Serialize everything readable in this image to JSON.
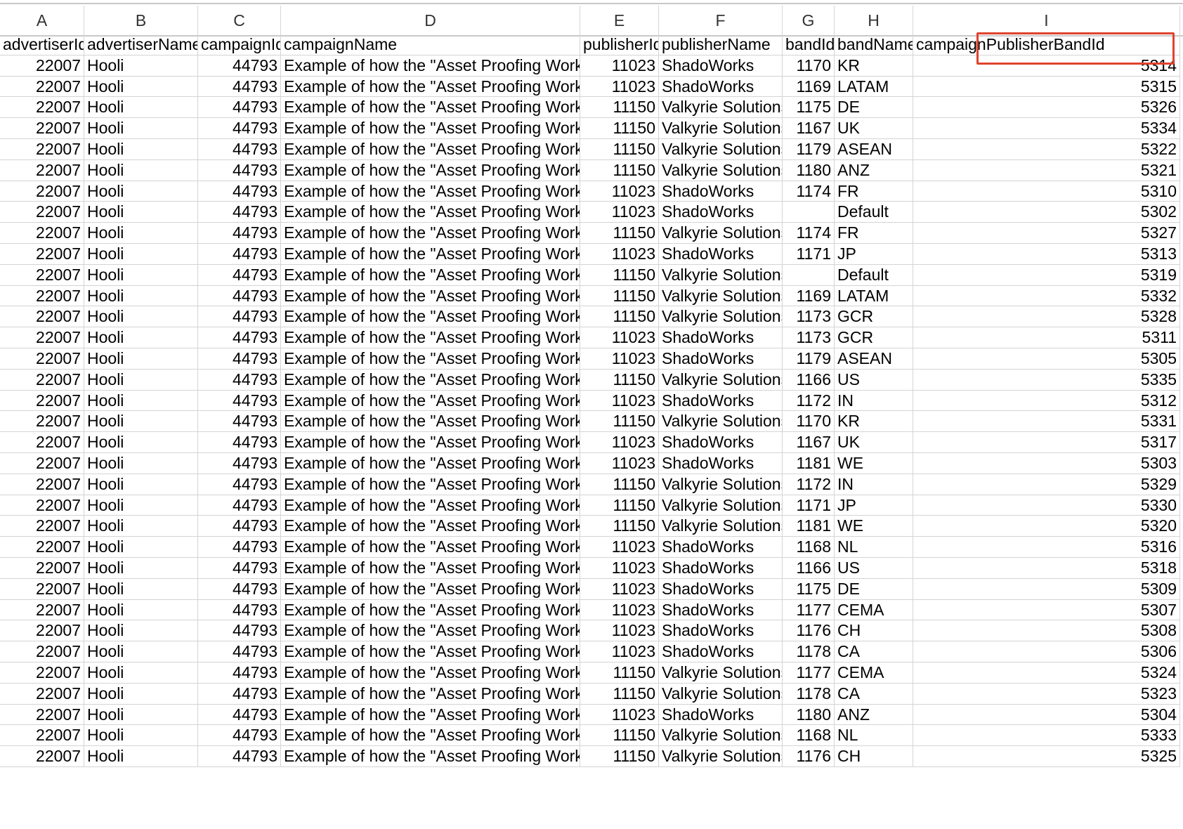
{
  "columns": [
    {
      "letter": "A",
      "header": "advertiserId",
      "key": "advertiserId",
      "align": "num"
    },
    {
      "letter": "B",
      "header": "advertiserName",
      "key": "advertiserName",
      "align": "txt"
    },
    {
      "letter": "C",
      "header": "campaignId",
      "key": "campaignId",
      "align": "num"
    },
    {
      "letter": "D",
      "header": "campaignName",
      "key": "campaignName",
      "align": "txt"
    },
    {
      "letter": "E",
      "header": "publisherId",
      "key": "publisherId",
      "align": "num"
    },
    {
      "letter": "F",
      "header": "publisherName",
      "key": "publisherName",
      "align": "txt"
    },
    {
      "letter": "G",
      "header": "bandId",
      "key": "bandId",
      "align": "num"
    },
    {
      "letter": "H",
      "header": "bandName",
      "key": "bandName",
      "align": "txt"
    },
    {
      "letter": "I",
      "header": "campaignPublisherBandId",
      "key": "campaignPublisherBandId",
      "align": "num"
    }
  ],
  "highlight_color": "#e0422e",
  "rows": [
    {
      "advertiserId": "22007",
      "advertiserName": "Hooli",
      "campaignId": "44793",
      "campaignName": "Example of how the \"Asset Proofing Works\"",
      "publisherId": "11023",
      "publisherName": "ShadoWorks",
      "bandId": "1170",
      "bandName": "KR",
      "campaignPublisherBandId": "5314"
    },
    {
      "advertiserId": "22007",
      "advertiserName": "Hooli",
      "campaignId": "44793",
      "campaignName": "Example of how the \"Asset Proofing Works\"",
      "publisherId": "11023",
      "publisherName": "ShadoWorks",
      "bandId": "1169",
      "bandName": "LATAM",
      "campaignPublisherBandId": "5315"
    },
    {
      "advertiserId": "22007",
      "advertiserName": "Hooli",
      "campaignId": "44793",
      "campaignName": "Example of how the \"Asset Proofing Works\"",
      "publisherId": "11150",
      "publisherName": "Valkyrie Solutions",
      "bandId": "1175",
      "bandName": "DE",
      "campaignPublisherBandId": "5326"
    },
    {
      "advertiserId": "22007",
      "advertiserName": "Hooli",
      "campaignId": "44793",
      "campaignName": "Example of how the \"Asset Proofing Works\"",
      "publisherId": "11150",
      "publisherName": "Valkyrie Solutions",
      "bandId": "1167",
      "bandName": "UK",
      "campaignPublisherBandId": "5334"
    },
    {
      "advertiserId": "22007",
      "advertiserName": "Hooli",
      "campaignId": "44793",
      "campaignName": "Example of how the \"Asset Proofing Works\"",
      "publisherId": "11150",
      "publisherName": "Valkyrie Solutions",
      "bandId": "1179",
      "bandName": "ASEAN",
      "campaignPublisherBandId": "5322"
    },
    {
      "advertiserId": "22007",
      "advertiserName": "Hooli",
      "campaignId": "44793",
      "campaignName": "Example of how the \"Asset Proofing Works\"",
      "publisherId": "11150",
      "publisherName": "Valkyrie Solutions",
      "bandId": "1180",
      "bandName": "ANZ",
      "campaignPublisherBandId": "5321"
    },
    {
      "advertiserId": "22007",
      "advertiserName": "Hooli",
      "campaignId": "44793",
      "campaignName": "Example of how the \"Asset Proofing Works\"",
      "publisherId": "11023",
      "publisherName": "ShadoWorks",
      "bandId": "1174",
      "bandName": "FR",
      "campaignPublisherBandId": "5310"
    },
    {
      "advertiserId": "22007",
      "advertiserName": "Hooli",
      "campaignId": "44793",
      "campaignName": "Example of how the \"Asset Proofing Works\"",
      "publisherId": "11023",
      "publisherName": "ShadoWorks",
      "bandId": "",
      "bandName": "Default",
      "campaignPublisherBandId": "5302"
    },
    {
      "advertiserId": "22007",
      "advertiserName": "Hooli",
      "campaignId": "44793",
      "campaignName": "Example of how the \"Asset Proofing Works\"",
      "publisherId": "11150",
      "publisherName": "Valkyrie Solutions",
      "bandId": "1174",
      "bandName": "FR",
      "campaignPublisherBandId": "5327"
    },
    {
      "advertiserId": "22007",
      "advertiserName": "Hooli",
      "campaignId": "44793",
      "campaignName": "Example of how the \"Asset Proofing Works\"",
      "publisherId": "11023",
      "publisherName": "ShadoWorks",
      "bandId": "1171",
      "bandName": "JP",
      "campaignPublisherBandId": "5313"
    },
    {
      "advertiserId": "22007",
      "advertiserName": "Hooli",
      "campaignId": "44793",
      "campaignName": "Example of how the \"Asset Proofing Works\"",
      "publisherId": "11150",
      "publisherName": "Valkyrie Solutions",
      "bandId": "",
      "bandName": "Default",
      "campaignPublisherBandId": "5319"
    },
    {
      "advertiserId": "22007",
      "advertiserName": "Hooli",
      "campaignId": "44793",
      "campaignName": "Example of how the \"Asset Proofing Works\"",
      "publisherId": "11150",
      "publisherName": "Valkyrie Solutions",
      "bandId": "1169",
      "bandName": "LATAM",
      "campaignPublisherBandId": "5332"
    },
    {
      "advertiserId": "22007",
      "advertiserName": "Hooli",
      "campaignId": "44793",
      "campaignName": "Example of how the \"Asset Proofing Works\"",
      "publisherId": "11150",
      "publisherName": "Valkyrie Solutions",
      "bandId": "1173",
      "bandName": "GCR",
      "campaignPublisherBandId": "5328"
    },
    {
      "advertiserId": "22007",
      "advertiserName": "Hooli",
      "campaignId": "44793",
      "campaignName": "Example of how the \"Asset Proofing Works\"",
      "publisherId": "11023",
      "publisherName": "ShadoWorks",
      "bandId": "1173",
      "bandName": "GCR",
      "campaignPublisherBandId": "5311"
    },
    {
      "advertiserId": "22007",
      "advertiserName": "Hooli",
      "campaignId": "44793",
      "campaignName": "Example of how the \"Asset Proofing Works\"",
      "publisherId": "11023",
      "publisherName": "ShadoWorks",
      "bandId": "1179",
      "bandName": "ASEAN",
      "campaignPublisherBandId": "5305"
    },
    {
      "advertiserId": "22007",
      "advertiserName": "Hooli",
      "campaignId": "44793",
      "campaignName": "Example of how the \"Asset Proofing Works\"",
      "publisherId": "11150",
      "publisherName": "Valkyrie Solutions",
      "bandId": "1166",
      "bandName": "US",
      "campaignPublisherBandId": "5335"
    },
    {
      "advertiserId": "22007",
      "advertiserName": "Hooli",
      "campaignId": "44793",
      "campaignName": "Example of how the \"Asset Proofing Works\"",
      "publisherId": "11023",
      "publisherName": "ShadoWorks",
      "bandId": "1172",
      "bandName": "IN",
      "campaignPublisherBandId": "5312"
    },
    {
      "advertiserId": "22007",
      "advertiserName": "Hooli",
      "campaignId": "44793",
      "campaignName": "Example of how the \"Asset Proofing Works\"",
      "publisherId": "11150",
      "publisherName": "Valkyrie Solutions",
      "bandId": "1170",
      "bandName": "KR",
      "campaignPublisherBandId": "5331"
    },
    {
      "advertiserId": "22007",
      "advertiserName": "Hooli",
      "campaignId": "44793",
      "campaignName": "Example of how the \"Asset Proofing Works\"",
      "publisherId": "11023",
      "publisherName": "ShadoWorks",
      "bandId": "1167",
      "bandName": "UK",
      "campaignPublisherBandId": "5317"
    },
    {
      "advertiserId": "22007",
      "advertiserName": "Hooli",
      "campaignId": "44793",
      "campaignName": "Example of how the \"Asset Proofing Works\"",
      "publisherId": "11023",
      "publisherName": "ShadoWorks",
      "bandId": "1181",
      "bandName": "WE",
      "campaignPublisherBandId": "5303"
    },
    {
      "advertiserId": "22007",
      "advertiserName": "Hooli",
      "campaignId": "44793",
      "campaignName": "Example of how the \"Asset Proofing Works\"",
      "publisherId": "11150",
      "publisherName": "Valkyrie Solutions",
      "bandId": "1172",
      "bandName": "IN",
      "campaignPublisherBandId": "5329"
    },
    {
      "advertiserId": "22007",
      "advertiserName": "Hooli",
      "campaignId": "44793",
      "campaignName": "Example of how the \"Asset Proofing Works\"",
      "publisherId": "11150",
      "publisherName": "Valkyrie Solutions",
      "bandId": "1171",
      "bandName": "JP",
      "campaignPublisherBandId": "5330"
    },
    {
      "advertiserId": "22007",
      "advertiserName": "Hooli",
      "campaignId": "44793",
      "campaignName": "Example of how the \"Asset Proofing Works\"",
      "publisherId": "11150",
      "publisherName": "Valkyrie Solutions",
      "bandId": "1181",
      "bandName": "WE",
      "campaignPublisherBandId": "5320"
    },
    {
      "advertiserId": "22007",
      "advertiserName": "Hooli",
      "campaignId": "44793",
      "campaignName": "Example of how the \"Asset Proofing Works\"",
      "publisherId": "11023",
      "publisherName": "ShadoWorks",
      "bandId": "1168",
      "bandName": "NL",
      "campaignPublisherBandId": "5316"
    },
    {
      "advertiserId": "22007",
      "advertiserName": "Hooli",
      "campaignId": "44793",
      "campaignName": "Example of how the \"Asset Proofing Works\"",
      "publisherId": "11023",
      "publisherName": "ShadoWorks",
      "bandId": "1166",
      "bandName": "US",
      "campaignPublisherBandId": "5318"
    },
    {
      "advertiserId": "22007",
      "advertiserName": "Hooli",
      "campaignId": "44793",
      "campaignName": "Example of how the \"Asset Proofing Works\"",
      "publisherId": "11023",
      "publisherName": "ShadoWorks",
      "bandId": "1175",
      "bandName": "DE",
      "campaignPublisherBandId": "5309"
    },
    {
      "advertiserId": "22007",
      "advertiserName": "Hooli",
      "campaignId": "44793",
      "campaignName": "Example of how the \"Asset Proofing Works\"",
      "publisherId": "11023",
      "publisherName": "ShadoWorks",
      "bandId": "1177",
      "bandName": "CEMA",
      "campaignPublisherBandId": "5307"
    },
    {
      "advertiserId": "22007",
      "advertiserName": "Hooli",
      "campaignId": "44793",
      "campaignName": "Example of how the \"Asset Proofing Works\"",
      "publisherId": "11023",
      "publisherName": "ShadoWorks",
      "bandId": "1176",
      "bandName": "CH",
      "campaignPublisherBandId": "5308"
    },
    {
      "advertiserId": "22007",
      "advertiserName": "Hooli",
      "campaignId": "44793",
      "campaignName": "Example of how the \"Asset Proofing Works\"",
      "publisherId": "11023",
      "publisherName": "ShadoWorks",
      "bandId": "1178",
      "bandName": "CA",
      "campaignPublisherBandId": "5306"
    },
    {
      "advertiserId": "22007",
      "advertiserName": "Hooli",
      "campaignId": "44793",
      "campaignName": "Example of how the \"Asset Proofing Works\"",
      "publisherId": "11150",
      "publisherName": "Valkyrie Solutions",
      "bandId": "1177",
      "bandName": "CEMA",
      "campaignPublisherBandId": "5324"
    },
    {
      "advertiserId": "22007",
      "advertiserName": "Hooli",
      "campaignId": "44793",
      "campaignName": "Example of how the \"Asset Proofing Works\"",
      "publisherId": "11150",
      "publisherName": "Valkyrie Solutions",
      "bandId": "1178",
      "bandName": "CA",
      "campaignPublisherBandId": "5323"
    },
    {
      "advertiserId": "22007",
      "advertiserName": "Hooli",
      "campaignId": "44793",
      "campaignName": "Example of how the \"Asset Proofing Works\"",
      "publisherId": "11023",
      "publisherName": "ShadoWorks",
      "bandId": "1180",
      "bandName": "ANZ",
      "campaignPublisherBandId": "5304"
    },
    {
      "advertiserId": "22007",
      "advertiserName": "Hooli",
      "campaignId": "44793",
      "campaignName": "Example of how the \"Asset Proofing Works\"",
      "publisherId": "11150",
      "publisherName": "Valkyrie Solutions",
      "bandId": "1168",
      "bandName": "NL",
      "campaignPublisherBandId": "5333"
    },
    {
      "advertiserId": "22007",
      "advertiserName": "Hooli",
      "campaignId": "44793",
      "campaignName": "Example of how the \"Asset Proofing Works\"",
      "publisherId": "11150",
      "publisherName": "Valkyrie Solutions",
      "bandId": "1176",
      "bandName": "CH",
      "campaignPublisherBandId": "5325"
    }
  ]
}
